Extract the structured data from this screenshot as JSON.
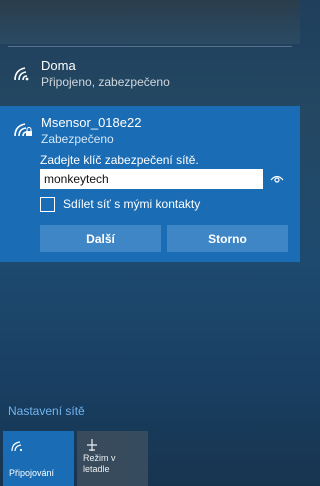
{
  "networks": [
    {
      "name": "Doma",
      "status": "Připojeno, zabezpečeno"
    },
    {
      "name": "Msensor_018e22",
      "status": "Zabezpečeno"
    }
  ],
  "connect_form": {
    "key_label": "Zadejte klíč zabezpečení sítě.",
    "key_value": "monkeytech",
    "share_label": "Sdílet síť s mými kontakty",
    "share_checked": false,
    "next_label": "Další",
    "cancel_label": "Storno"
  },
  "settings_link": "Nastavení sítě",
  "quick_actions": [
    {
      "label": "Připojování",
      "icon": "wifi-icon",
      "active": true
    },
    {
      "label": "Režim v letadle",
      "icon": "airplane-icon",
      "active": false
    }
  ],
  "colors": {
    "accent": "#1a6cb4",
    "button": "#3f86c6",
    "link": "#71b4ef"
  }
}
